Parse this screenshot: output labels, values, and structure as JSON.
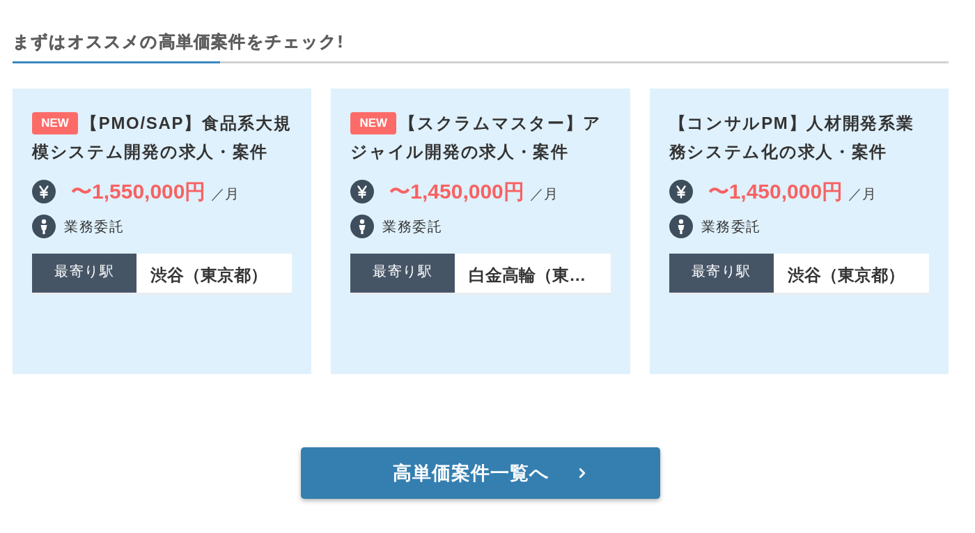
{
  "heading": "まずはオススメの高単価案件をチェック!",
  "jobs": [
    {
      "badge": "NEW",
      "title": "【PMO/SAP】食品系大規模システム開発の求人・案件",
      "price": "〜1,550,000円",
      "price_unit": "／月",
      "contract": "業務委託",
      "station_label": "最寄り駅",
      "station": "渋谷（東京都）"
    },
    {
      "badge": "NEW",
      "title": "【スクラムマスター】アジャイル開発の求人・案件",
      "price": "〜1,450,000円",
      "price_unit": "／月",
      "contract": "業務委託",
      "station_label": "最寄り駅",
      "station": "白金高輪（東…"
    },
    {
      "title": "【コンサルPM】人材開発系業務システム化の求人・案件",
      "price": "〜1,450,000円",
      "price_unit": "／月",
      "contract": "業務委託",
      "station_label": "最寄り駅",
      "station": "渋谷（東京都）"
    }
  ],
  "more_button": {
    "label": "高単価案件一覧へ"
  }
}
